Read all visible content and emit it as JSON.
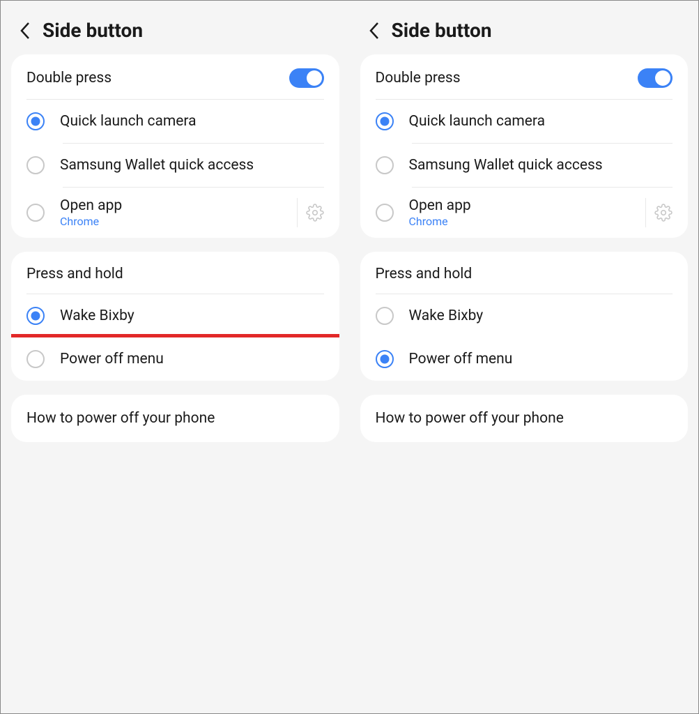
{
  "screens": [
    {
      "title": "Side button",
      "double_press": {
        "header": "Double press",
        "toggled": true,
        "selected": 0,
        "options": [
          {
            "label": "Quick launch camera"
          },
          {
            "label": "Samsung Wallet quick access"
          },
          {
            "label": "Open app",
            "sublabel": "Chrome",
            "has_gear": true
          }
        ]
      },
      "press_hold": {
        "header": "Press and hold",
        "selected": 0,
        "options": [
          {
            "label": "Wake Bixby"
          },
          {
            "label": "Power off menu",
            "highlighted": true
          }
        ]
      },
      "link": "How to power off your phone"
    },
    {
      "title": "Side button",
      "double_press": {
        "header": "Double press",
        "toggled": true,
        "selected": 0,
        "options": [
          {
            "label": "Quick launch camera"
          },
          {
            "label": "Samsung Wallet quick access"
          },
          {
            "label": "Open app",
            "sublabel": "Chrome",
            "has_gear": true
          }
        ]
      },
      "press_hold": {
        "header": "Press and hold",
        "selected": 1,
        "options": [
          {
            "label": "Wake Bixby"
          },
          {
            "label": "Power off menu"
          }
        ]
      },
      "link": "How to power off your phone"
    }
  ]
}
